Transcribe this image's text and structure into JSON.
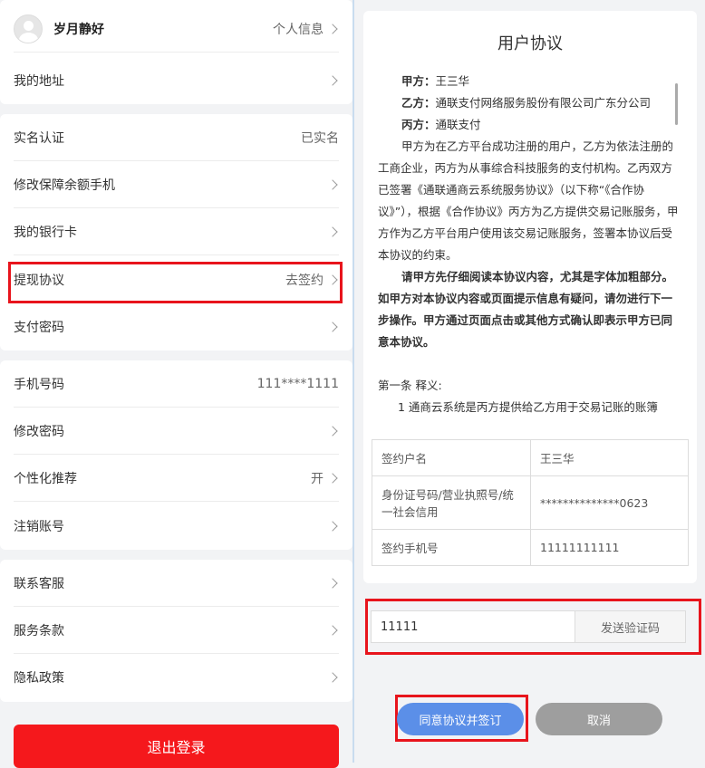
{
  "profile": {
    "username": "岁月静好",
    "info_label": "个人信息"
  },
  "menu": {
    "address": "我的地址",
    "realname": {
      "label": "实名认证",
      "value": "已实名"
    },
    "change_phone": "修改保障余额手机",
    "bank_card": "我的银行卡",
    "withdraw": {
      "label": "提现协议",
      "value": "去签约"
    },
    "pay_password": "支付密码",
    "phone": {
      "label": "手机号码",
      "value": "111****1111"
    },
    "change_password": "修改密码",
    "personalize": {
      "label": "个性化推荐",
      "value": "开"
    },
    "cancel_account": "注销账号",
    "contact": "联系客服",
    "terms": "服务条款",
    "privacy": "隐私政策"
  },
  "logout_label": "退出登录",
  "agreement": {
    "title": "用户协议",
    "party_a_label": "甲方：",
    "party_a": "王三华",
    "party_b_label": "乙方：",
    "party_b": "通联支付网络服务股份有限公司广东分公司",
    "party_c_label": "丙方：",
    "party_c": "通联支付",
    "para1": "甲方为在乙方平台成功注册的用户，乙方为依法注册的工商企业，丙方为从事综合科技服务的支付机构。乙丙双方已签署《通联通商云系统服务协议》（以下称“《合作协议》”），根据《合作协议》丙方为乙方提供交易记账服务，甲方作为乙方平台用户使用该交易记账服务，签署本协议后受本协议的约束。",
    "para2": "请甲方先仔细阅读本协议内容，尤其是字体加粗部分。如甲方对本协议内容或页面提示信息有疑问，请勿进行下一步操作。甲方通过页面点击或其他方式确认即表示甲方已同意本协议。",
    "article1": "第一条  释义:",
    "article1_item": "1    通商云系统是丙方提供给乙方用于交易记账的账簿"
  },
  "sign_table": [
    {
      "key": "签约户名",
      "value": "王三华"
    },
    {
      "key": "身份证号码/营业执照号/统一社会信用",
      "value": "**************0623"
    },
    {
      "key": "签约手机号",
      "value": "11111111111"
    }
  ],
  "verify": {
    "code_value": "11111",
    "send_label": "发送验证码"
  },
  "actions": {
    "agree_label": "同意协议并签订",
    "cancel_label": "取消"
  },
  "colors": {
    "highlight": "#e8141c",
    "logout": "#f5181c",
    "agree": "#5b8fe8",
    "cancel": "#9e9e9e"
  },
  "icons": {
    "chevron": "chevron-right-icon",
    "avatar": "avatar-icon"
  }
}
